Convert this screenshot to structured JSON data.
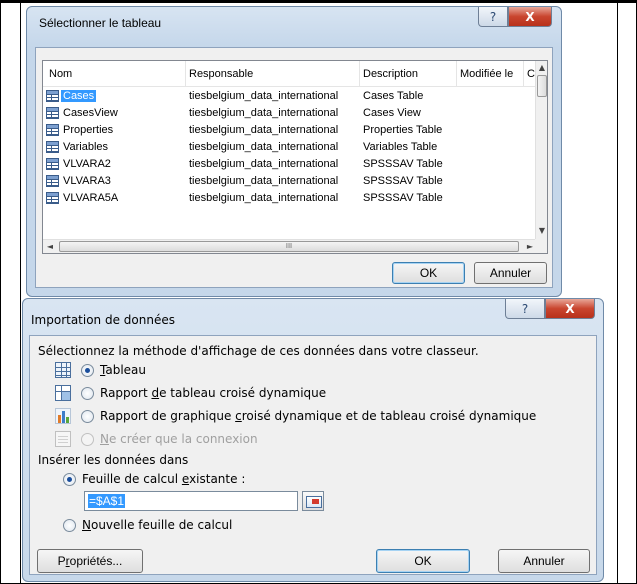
{
  "dialog_table": {
    "title": "Sélectionner le tableau",
    "columns": [
      "Nom",
      "Responsable",
      "Description",
      "Modifiée le",
      "C"
    ],
    "rows": [
      {
        "name": "Cases",
        "owner": "tiesbelgium_data_international",
        "description": "Cases Table",
        "selected": true
      },
      {
        "name": "CasesView",
        "owner": "tiesbelgium_data_international",
        "description": "Cases View",
        "selected": false
      },
      {
        "name": "Properties",
        "owner": "tiesbelgium_data_international",
        "description": "Properties Table",
        "selected": false
      },
      {
        "name": "Variables",
        "owner": "tiesbelgium_data_international",
        "description": "Variables Table",
        "selected": false
      },
      {
        "name": "VLVARA2",
        "owner": "tiesbelgium_data_international",
        "description": "SPSSSAV Table",
        "selected": false
      },
      {
        "name": "VLVARA3",
        "owner": "tiesbelgium_data_international",
        "description": "SPSSSAV Table",
        "selected": false
      },
      {
        "name": "VLVARA5A",
        "owner": "tiesbelgium_data_international",
        "description": "SPSSSAV Table",
        "selected": false
      }
    ],
    "ok_label": "OK",
    "cancel_label": "Annuler",
    "help_glyph": "?",
    "close_glyph": "X"
  },
  "dialog_import": {
    "title": "Importation de données",
    "prompt": "Sélectionnez la méthode d'affichage de ces données dans votre classeur.",
    "view_options": [
      {
        "icon": "table-icon",
        "before": "",
        "key": "T",
        "after": "ableau",
        "checked": true,
        "disabled": false
      },
      {
        "icon": "pivot-table-icon",
        "before": "Rapport ",
        "key": "d",
        "after": "e tableau croisé dynamique",
        "checked": false,
        "disabled": false
      },
      {
        "icon": "pivot-chart-icon",
        "before": "Rapport de graphique ",
        "key": "c",
        "after": "roisé dynamique et de tableau croisé dynamique",
        "checked": false,
        "disabled": false
      },
      {
        "icon": "connection-icon",
        "before": "",
        "key": "N",
        "after": "e créer que la connexion",
        "checked": false,
        "disabled": true
      }
    ],
    "insert_label": "Insérer les données dans",
    "existing_sheet": {
      "before": "Feuille de calcul ",
      "key": "e",
      "after": "xistante :",
      "checked": true
    },
    "reference_value": "=$A$1",
    "new_sheet": {
      "before": "",
      "key": "N",
      "after": "ouvelle feuille de calcul",
      "checked": false
    },
    "properties_label": {
      "before": "P",
      "key": "r",
      "after": "opriétés..."
    },
    "ok_label": "OK",
    "cancel_label": "Annuler",
    "help_glyph": "?",
    "close_glyph": "X"
  },
  "scrollbar": {
    "up": "▲",
    "down": "▼",
    "left": "◄",
    "right": "►",
    "grip": "III"
  }
}
